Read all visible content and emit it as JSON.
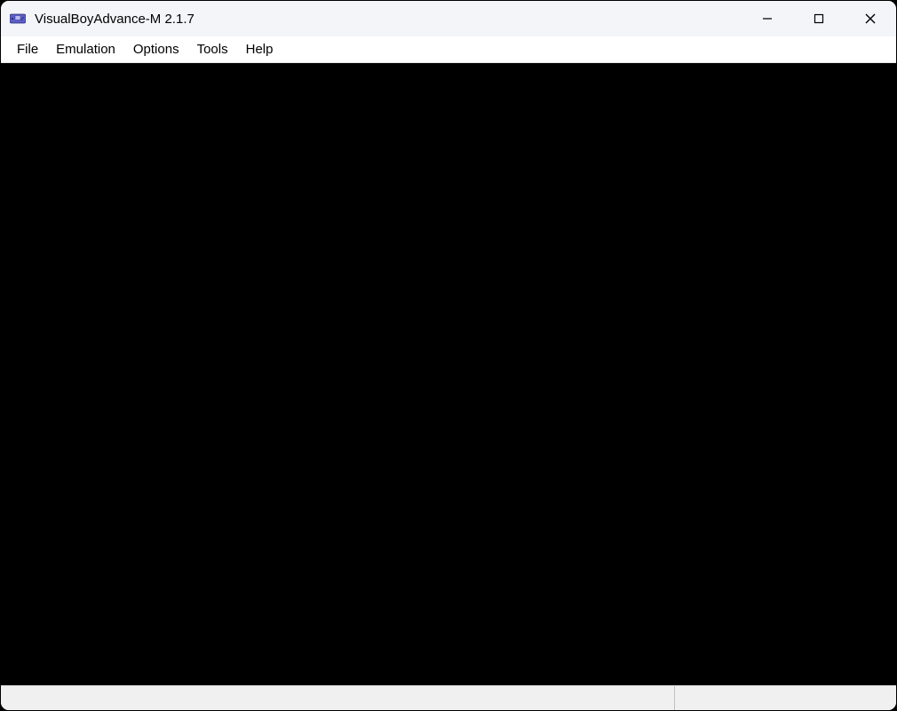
{
  "titlebar": {
    "title": "VisualBoyAdvance-M 2.1.7",
    "icon_name": "vbam-app-icon"
  },
  "window_controls": {
    "minimize": "minimize",
    "maximize": "maximize",
    "close": "close"
  },
  "menubar": {
    "items": [
      {
        "label": "File"
      },
      {
        "label": "Emulation"
      },
      {
        "label": "Options"
      },
      {
        "label": "Tools"
      },
      {
        "label": "Help"
      }
    ]
  },
  "viewport": {
    "state": "empty"
  },
  "statusbar": {
    "main_text": "",
    "right_text": ""
  }
}
